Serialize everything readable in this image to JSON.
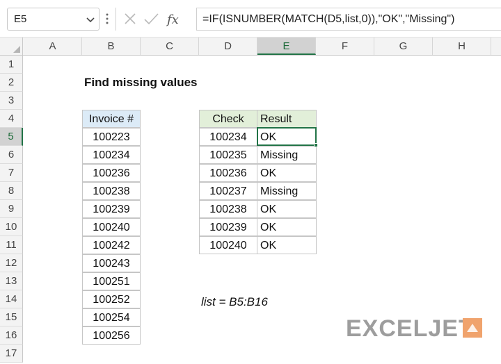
{
  "formula_bar": {
    "name_box": "E5",
    "formula": "=IF(ISNUMBER(MATCH(D5,list,0)),\"OK\",\"Missing\")"
  },
  "columns": [
    "A",
    "B",
    "C",
    "D",
    "E",
    "F",
    "G",
    "H"
  ],
  "active_column": "E",
  "rows": [
    "1",
    "2",
    "3",
    "4",
    "5",
    "6",
    "7",
    "8",
    "9",
    "10",
    "11",
    "12",
    "13",
    "14",
    "15",
    "16",
    "17"
  ],
  "active_row": "5",
  "sheet": {
    "title": "Find missing values",
    "invoice_header": "Invoice #",
    "invoices": [
      "100223",
      "100234",
      "100236",
      "100238",
      "100239",
      "100240",
      "100242",
      "100243",
      "100251",
      "100252",
      "100254",
      "100256"
    ],
    "check_header": "Check",
    "result_header": "Result",
    "checks": [
      {
        "check": "100234",
        "result": "OK"
      },
      {
        "check": "100235",
        "result": "Missing"
      },
      {
        "check": "100236",
        "result": "OK"
      },
      {
        "check": "100237",
        "result": "Missing"
      },
      {
        "check": "100238",
        "result": "OK"
      },
      {
        "check": "100239",
        "result": "OK"
      },
      {
        "check": "100240",
        "result": "OK"
      }
    ],
    "named_range_note": "list = B5:B16"
  },
  "logo": {
    "text": "EXCELJET"
  },
  "colors": {
    "accent": "#217346",
    "invoice_header_bg": "#dcebf7",
    "check_header_bg": "#e2efd9"
  }
}
